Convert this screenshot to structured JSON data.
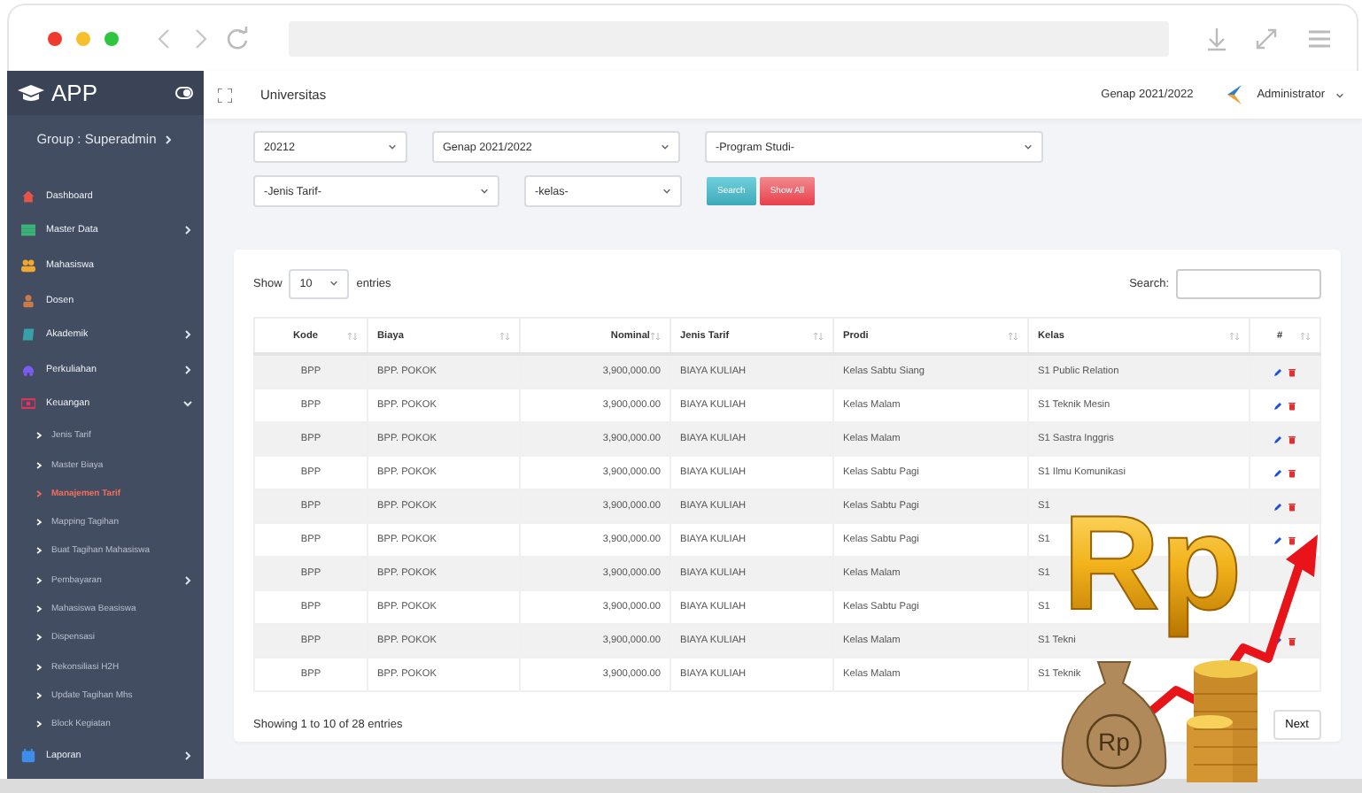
{
  "sidebar": {
    "app_name": "APP",
    "group": "Group : Superadmin",
    "items": [
      {
        "label": "Dashboard",
        "kind": "home"
      },
      {
        "label": "Master Data",
        "kind": "table",
        "expanded": false
      },
      {
        "label": "Mahasiswa",
        "kind": "users"
      },
      {
        "label": "Dosen",
        "kind": "person"
      },
      {
        "label": "Akademik",
        "kind": "book",
        "expanded": false
      },
      {
        "label": "Perkuliahan",
        "kind": "car",
        "expanded": false
      },
      {
        "label": "Keuangan",
        "kind": "money",
        "expanded": true,
        "children": [
          {
            "label": "Jenis Tarif",
            "selected": false
          },
          {
            "label": "Master Biaya",
            "selected": false
          },
          {
            "label": "Manajemen Tarif",
            "selected": true
          },
          {
            "label": "Mapping Tagihan",
            "selected": false
          },
          {
            "label": "Buat Tagihan Mahasiswa",
            "selected": false
          },
          {
            "label": "Pembayaran",
            "selected": false,
            "expanded": false
          },
          {
            "label": "Mahasiswa Beasiswa",
            "selected": false
          },
          {
            "label": "Dispensasi",
            "selected": false
          },
          {
            "label": "Rekonsiliasi H2H",
            "selected": false
          },
          {
            "label": "Update Tagihan Mhs",
            "selected": false
          },
          {
            "label": "Block Kegiatan",
            "selected": false
          }
        ]
      },
      {
        "label": "Laporan",
        "kind": "calendar",
        "expanded": false
      }
    ]
  },
  "header": {
    "title": "Universitas",
    "period": "Genap 2021/2022",
    "user": "Administrator"
  },
  "filters": [
    {
      "value": "20212"
    },
    {
      "value": "Genap 2021/2022"
    },
    {
      "value": "-Program Studi-"
    },
    {
      "value": "-Jenis Tarif-"
    },
    {
      "value": "-kelas-"
    }
  ],
  "filter_buttons": [
    {
      "label": "Search",
      "kind": "search"
    },
    {
      "label": "Show All",
      "kind": "reset"
    }
  ],
  "table": {
    "show_label": "Show",
    "page_size": "10",
    "entries_label": "entries",
    "search_label": "Search:",
    "columns": [
      "Kode",
      "Biaya",
      "Nominal",
      "Jenis Tarif",
      "Prodi",
      "Kelas",
      "#"
    ],
    "rows": [
      {
        "cells": [
          "BPP",
          "BPP. POKOK",
          "3,900,000.00",
          "BIAYA KULIAH",
          "Kelas Sabtu Siang",
          "S1 Public Relation"
        ],
        "actions": true
      },
      {
        "cells": [
          "BPP",
          "BPP. POKOK",
          "3,900,000.00",
          "BIAYA KULIAH",
          "Kelas Malam",
          "S1 Teknik Mesin"
        ],
        "actions": true
      },
      {
        "cells": [
          "BPP",
          "BPP. POKOK",
          "3,900,000.00",
          "BIAYA KULIAH",
          "Kelas Malam",
          "S1 Sastra Inggris"
        ],
        "actions": true
      },
      {
        "cells": [
          "BPP",
          "BPP. POKOK",
          "3,900,000.00",
          "BIAYA KULIAH",
          "Kelas Sabtu Pagi",
          "S1 Ilmu Komunikasi"
        ],
        "actions": true
      },
      {
        "cells": [
          "BPP",
          "BPP. POKOK",
          "3,900,000.00",
          "BIAYA KULIAH",
          "Kelas Sabtu Pagi",
          "S1"
        ],
        "actions": true
      },
      {
        "cells": [
          "BPP",
          "BPP. POKOK",
          "3,900,000.00",
          "BIAYA KULIAH",
          "Kelas Sabtu Pagi",
          "S1"
        ],
        "actions": true
      },
      {
        "cells": [
          "BPP",
          "BPP. POKOK",
          "3,900,000.00",
          "BIAYA KULIAH",
          "Kelas Malam",
          "S1"
        ],
        "actions": false
      },
      {
        "cells": [
          "BPP",
          "BPP. POKOK",
          "3,900,000.00",
          "BIAYA KULIAH",
          "Kelas Sabtu Pagi",
          "S1"
        ],
        "actions": false
      },
      {
        "cells": [
          "BPP",
          "BPP. POKOK",
          "3,900,000.00",
          "BIAYA KULIAH",
          "Kelas Malam",
          "S1 Tekni"
        ],
        "actions": true
      },
      {
        "cells": [
          "BPP",
          "BPP. POKOK",
          "3,900,000.00",
          "BIAYA KULIAH",
          "Kelas Malam",
          "S1 Teknik"
        ],
        "actions": false
      }
    ],
    "info": "Showing 1 to 10 of 28 entries",
    "next": "Next"
  },
  "overlay": {
    "symbol": "Rp",
    "bag_label": "Rp"
  }
}
